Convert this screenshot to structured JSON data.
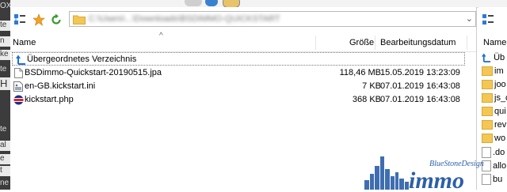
{
  "background_window": {
    "labels": [
      "OX",
      "te",
      "n",
      "ke",
      "te",
      "H",
      "te",
      "al",
      "e",
      "t",
      "tt",
      "ne"
    ]
  },
  "toolbar": {
    "icons": [
      "list-view-icon",
      "bookmark-star-icon",
      "refresh-icon"
    ],
    "path_value": "C:\\Users\\...\\Downloads\\BSDIMMO-QUICKSTART"
  },
  "columns": {
    "name": "Name",
    "size": "Größe",
    "modified": "Bearbeitungsdatum"
  },
  "files": [
    {
      "name": "Übergeordnetes Verzeichnis",
      "size": "",
      "date": "",
      "icon": "parent-dir-icon"
    },
    {
      "name": "BSDimmo-Quickstart-20190515.jpa",
      "size": "118,46 MB",
      "date": "15.05.2019 13:23:09",
      "icon": "file-icon"
    },
    {
      "name": "en-GB.kickstart.ini",
      "size": "7 KB",
      "date": "07.01.2019 16:43:08",
      "icon": "ini-file-icon"
    },
    {
      "name": "kickstart.php",
      "size": "368 KB",
      "date": "07.01.2019 16:43:08",
      "icon": "php-file-icon"
    }
  ],
  "remote_pane": {
    "header": "Name",
    "items": [
      {
        "label": "Üb",
        "kind": "parent"
      },
      {
        "label": "im",
        "kind": "folder"
      },
      {
        "label": "joo",
        "kind": "folder"
      },
      {
        "label": "js_c",
        "kind": "folder"
      },
      {
        "label": "qui",
        "kind": "folder"
      },
      {
        "label": "rev",
        "kind": "folder"
      },
      {
        "label": "wo",
        "kind": "folder"
      },
      {
        "label": ".do",
        "kind": "file"
      },
      {
        "label": "allo",
        "kind": "file"
      },
      {
        "label": "bu",
        "kind": "file"
      }
    ]
  },
  "watermark": {
    "brand": "immo",
    "tagline": "BlueStoneDesign"
  },
  "colors": {
    "accent_blue": "#1e6fd0",
    "folder_yellow": "#f4c653",
    "watermark_blue": "#2b5fa8"
  }
}
